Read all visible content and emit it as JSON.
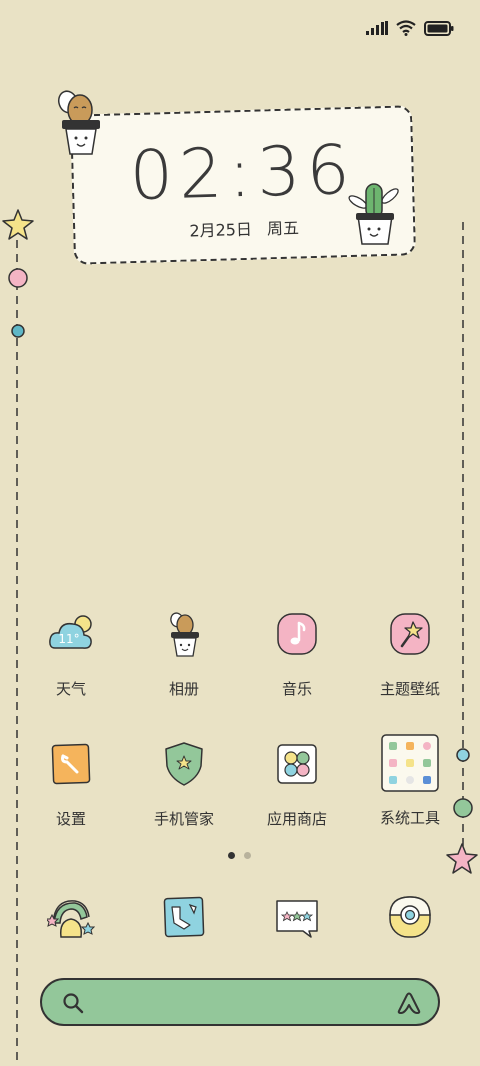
{
  "status_bar": {
    "icons": [
      "signal-icon",
      "wifi-icon",
      "battery-icon"
    ]
  },
  "clock_widget": {
    "time": "02:36",
    "date": "2月25日 周五"
  },
  "apps": [
    {
      "label": "天气",
      "icon": "weather-icon",
      "temperature": "11°"
    },
    {
      "label": "相册",
      "icon": "gallery-icon"
    },
    {
      "label": "音乐",
      "icon": "music-icon"
    },
    {
      "label": "主题壁纸",
      "icon": "themes-icon"
    },
    {
      "label": "设置",
      "icon": "settings-icon"
    },
    {
      "label": "手机管家",
      "icon": "security-icon"
    },
    {
      "label": "应用商店",
      "icon": "app-store-icon"
    },
    {
      "label": "系统工具",
      "icon": "tools-folder-icon"
    }
  ],
  "page_indicator": {
    "pages": 2,
    "current": 1
  },
  "dock": [
    "phone-icon",
    "browser-icon",
    "messages-icon",
    "camera-icon"
  ],
  "search_bar": {
    "icons": [
      "search-icon",
      "assistant-icon"
    ]
  },
  "colors": {
    "background": "#e9e2c5",
    "card": "#fbf9ee",
    "search_bar": "#93c79a",
    "accent_pink": "#f4b4c4",
    "accent_blue": "#8fd3e0",
    "accent_yellow": "#f5e38a",
    "accent_green": "#93c79a"
  }
}
